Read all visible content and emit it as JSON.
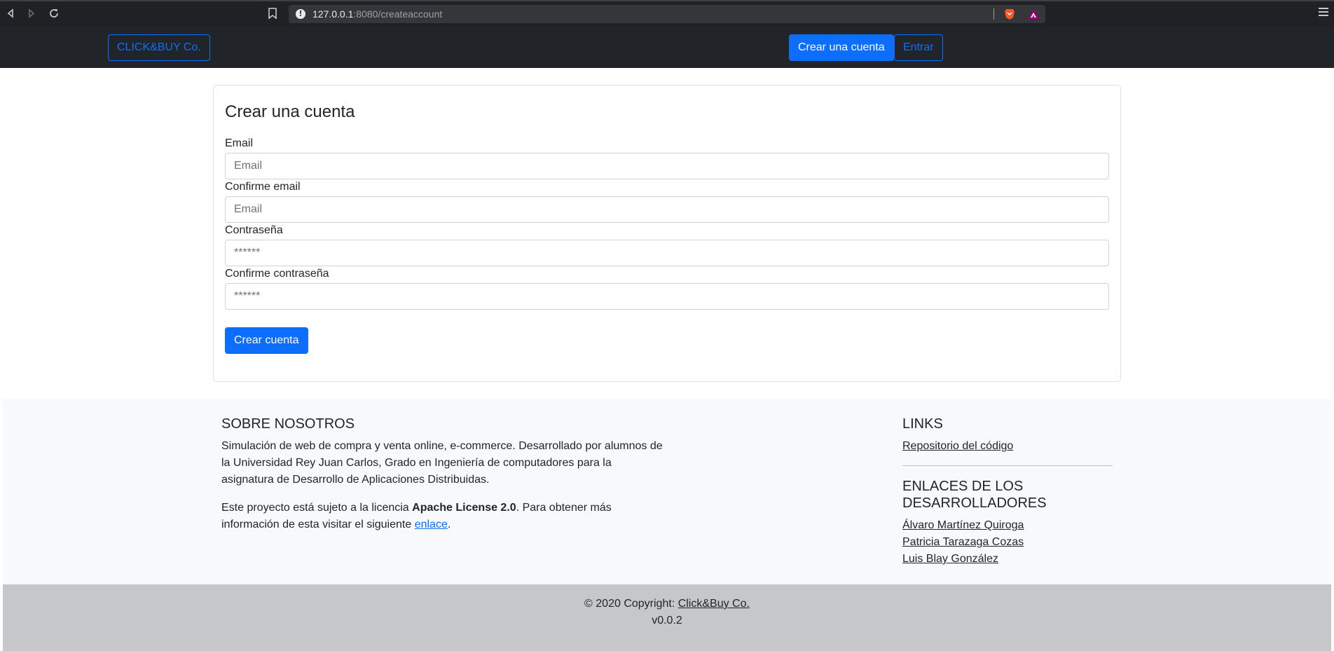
{
  "browser": {
    "url_host": "127.0.0.1",
    "url_path": ":8080/createaccount"
  },
  "navbar": {
    "brand": "CLICK&BUY Co.",
    "create_account": "Crear una cuenta",
    "login": "Entrar"
  },
  "form": {
    "title": "Crear una cuenta",
    "fields": [
      {
        "label": "Email",
        "placeholder": "Email"
      },
      {
        "label": "Confirme email",
        "placeholder": "Email"
      },
      {
        "label": "Contraseña",
        "placeholder": "******"
      },
      {
        "label": "Confirme contraseña",
        "placeholder": "******"
      }
    ],
    "submit": "Crear cuenta"
  },
  "footer": {
    "about_title": "SOBRE NOSOTROS",
    "about_text": "Simulación de web de compra y venta online, e-commerce. Desarrollado por alumnos de la Universidad Rey Juan Carlos, Grado en Ingeniería de computadores para la asignatura de Desarrollo de Aplicaciones Distribuidas.",
    "license_pre": "Este proyecto está sujeto a la licencia ",
    "license_name": "Apache License 2.0",
    "license_mid": ". Para obtener más información de esta visitar el siguiente ",
    "license_link": "enlace",
    "license_post": ".",
    "links_title": "LINKS",
    "repo_link": "Repositorio del código",
    "devs_title_1": "ENLACES DE LOS",
    "devs_title_2": "DESARROLLADORES",
    "devs": [
      "Álvaro Martínez Quiroga",
      "Patricia Tarazaga Cozas",
      "Luis Blay González"
    ]
  },
  "copyright": {
    "prefix": "© 2020 Copyright: ",
    "link": "Click&Buy Co.",
    "version": "v0.0.2"
  }
}
